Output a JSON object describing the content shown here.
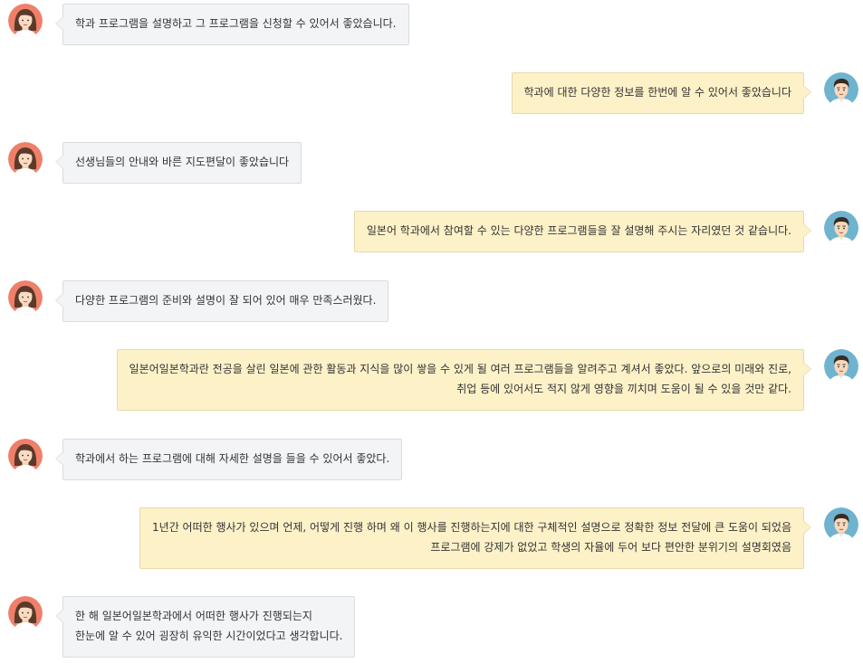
{
  "colors": {
    "left_bubble_bg": "#f3f4f6",
    "right_bubble_bg": "#fdf1c8",
    "female_avatar_bg": "#f07f6a",
    "male_avatar_bg": "#6fb3cf"
  },
  "messages": [
    {
      "side": "left",
      "avatar": "female-avatar-icon",
      "lines": [
        "학과 프로그램을 설명하고 그 프로그램을 신청할 수 있어서 좋았습니다."
      ]
    },
    {
      "side": "right",
      "avatar": "male-avatar-icon",
      "lines": [
        "학과에 대한 다양한 정보를 한번에 알 수 있어서 좋았습니다"
      ]
    },
    {
      "side": "left",
      "avatar": "female-avatar-icon",
      "lines": [
        "선생님들의 안내와 바른 지도편달이 좋았습니다"
      ]
    },
    {
      "side": "right",
      "avatar": "male-avatar-icon",
      "lines": [
        "일본어 학과에서 참여할 수 있는 다양한 프로그램들을 잘 설명해 주시는 자리였던 것 같습니다."
      ]
    },
    {
      "side": "left",
      "avatar": "female-avatar-icon",
      "lines": [
        "다양한 프로그램의 준비와 설명이 잘 되어 있어 매우 만족스러웠다."
      ]
    },
    {
      "side": "right",
      "avatar": "male-avatar-icon",
      "lines": [
        "일본어일본학과란 전공을 살린 일본에 관한 활동과 지식을 많이 쌓을 수 있게 될 여러 프로그램들을 알려주고 계셔서 좋았다. 앞으로의 미래와 진로,",
        "취업 등에 있어서도 적지 않게 영향을 끼치며 도움이 될 수 있을 것만 같다."
      ]
    },
    {
      "side": "left",
      "avatar": "female-avatar-icon",
      "lines": [
        "학과에서 하는 프로그램에 대해 자세한 설명을 들을 수 있어서 좋았다."
      ]
    },
    {
      "side": "right",
      "avatar": "male-avatar-icon",
      "lines": [
        "1년간 어떠한 행사가 있으며 언제, 어떻게 진행 하며 왜 이 행사를 진행하는지에 대한 구체적인 설명으로 정확한 정보 전달에 큰 도움이 되었음",
        "프로그램에 강제가 없었고 학생의 자율에 두어 보다 편안한 분위기의 설명회였음"
      ]
    },
    {
      "side": "left",
      "avatar": "female-avatar-icon",
      "lines": [
        "한 해 일본어일본학과에서 어떠한 행사가 진행되는지",
        "한눈에 알 수 있어 굉장히 유익한 시간이었다고 생각합니다."
      ]
    }
  ]
}
